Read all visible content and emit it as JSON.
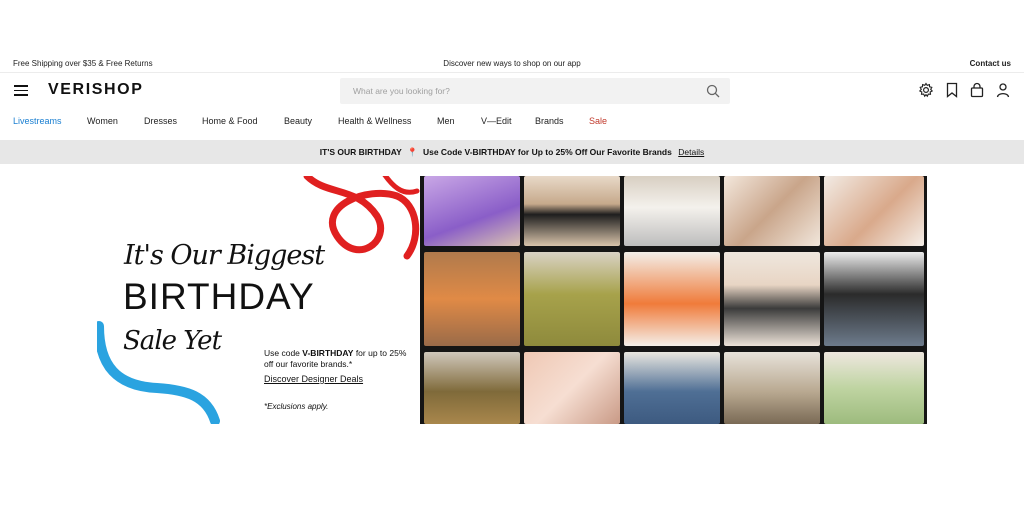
{
  "topbar": {
    "shipping": "Free Shipping over $35 & Free Returns",
    "app": "Discover new ways to shop on our app",
    "contact": "Contact us"
  },
  "header": {
    "logo": "VERISHOP",
    "search_placeholder": "What are you looking for?"
  },
  "nav": {
    "items": [
      "Livestreams",
      "Women",
      "Dresses",
      "Home & Food",
      "Beauty",
      "Health & Wellness",
      "Men",
      "V—Edit",
      "Brands",
      "Sale"
    ]
  },
  "promo": {
    "text": "IT'S OUR BIRTHDAY",
    "text2": "Use Code V-BIRTHDAY for Up to 25% Off Our Favorite Brands",
    "details": "Details"
  },
  "hero": {
    "line1": "It's Our Biggest",
    "line2": "BIRTHDAY",
    "line3": "Sale Yet",
    "desc_prefix": "Use code ",
    "desc_code": "V-BIRTHDAY",
    "desc_suffix": " for up to 25% off our favorite brands.*",
    "link": "Discover Designer Deals",
    "exclusions": "*Exclusions apply."
  },
  "colors": {
    "accent_blue": "#1a7fd1",
    "sale_red": "#c0392b",
    "promo_bg": "#e7e7e7",
    "ribbon_red": "#e02020",
    "ribbon_blue": "#2aa3e0"
  }
}
